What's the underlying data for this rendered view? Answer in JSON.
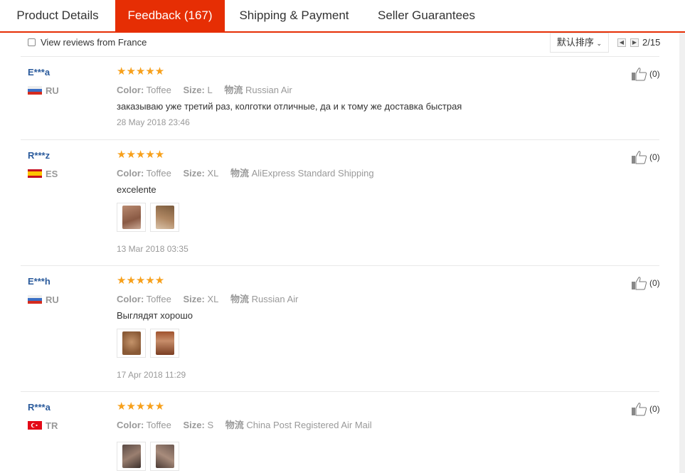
{
  "tabs": [
    {
      "label": "Product Details"
    },
    {
      "label": "Feedback (167)"
    },
    {
      "label": "Shipping & Payment"
    },
    {
      "label": "Seller Guarantees"
    }
  ],
  "filter": {
    "label": "View reviews from France",
    "checked": false
  },
  "sort": {
    "label": "默认排序"
  },
  "pagination": {
    "text": "2/15",
    "prev_icon": "chevron-left-icon",
    "next_icon": "chevron-right-icon"
  },
  "reviews": [
    {
      "user": "E***a",
      "country": "RU",
      "flag": "russia",
      "rating": "★★★★★",
      "color_label": "Color:",
      "color": "Toffee",
      "size_label": "Size:",
      "size": "L",
      "logistics_label": "物流",
      "logistics": "Russian Air",
      "comment": "заказываю уже третий раз, колготки отличные, да и к тому же доставка быстрая",
      "date": "28 May 2018 23:46",
      "likes": "(0)"
    },
    {
      "user": "R***z",
      "country": "ES",
      "flag": "spain",
      "rating": "★★★★★",
      "color_label": "Color:",
      "color": "Toffee",
      "size_label": "Size:",
      "size": "XL",
      "logistics_label": "物流",
      "logistics": "AliExpress Standard Shipping",
      "comment": "excelente",
      "date": "13 Mar 2018 03:35",
      "likes": "(0)"
    },
    {
      "user": "E***h",
      "country": "RU",
      "flag": "russia",
      "rating": "★★★★★",
      "color_label": "Color:",
      "color": "Toffee",
      "size_label": "Size:",
      "size": "XL",
      "logistics_label": "物流",
      "logistics": "Russian Air",
      "comment": "Выглядят хорошо",
      "date": "17 Apr 2018 11:29",
      "likes": "(0)"
    },
    {
      "user": "R***a",
      "country": "TR",
      "flag": "turkey",
      "rating": "★★★★★",
      "color_label": "Color:",
      "color": "Toffee",
      "size_label": "Size:",
      "size": "S",
      "logistics_label": "物流",
      "logistics": "China Post Registered Air Mail",
      "comment": "",
      "date": "",
      "likes": "(0)"
    }
  ],
  "colors": {
    "accent": "#e62e04",
    "user": "#2b5b9c",
    "star": "#f7a01b",
    "muted": "#999999"
  }
}
